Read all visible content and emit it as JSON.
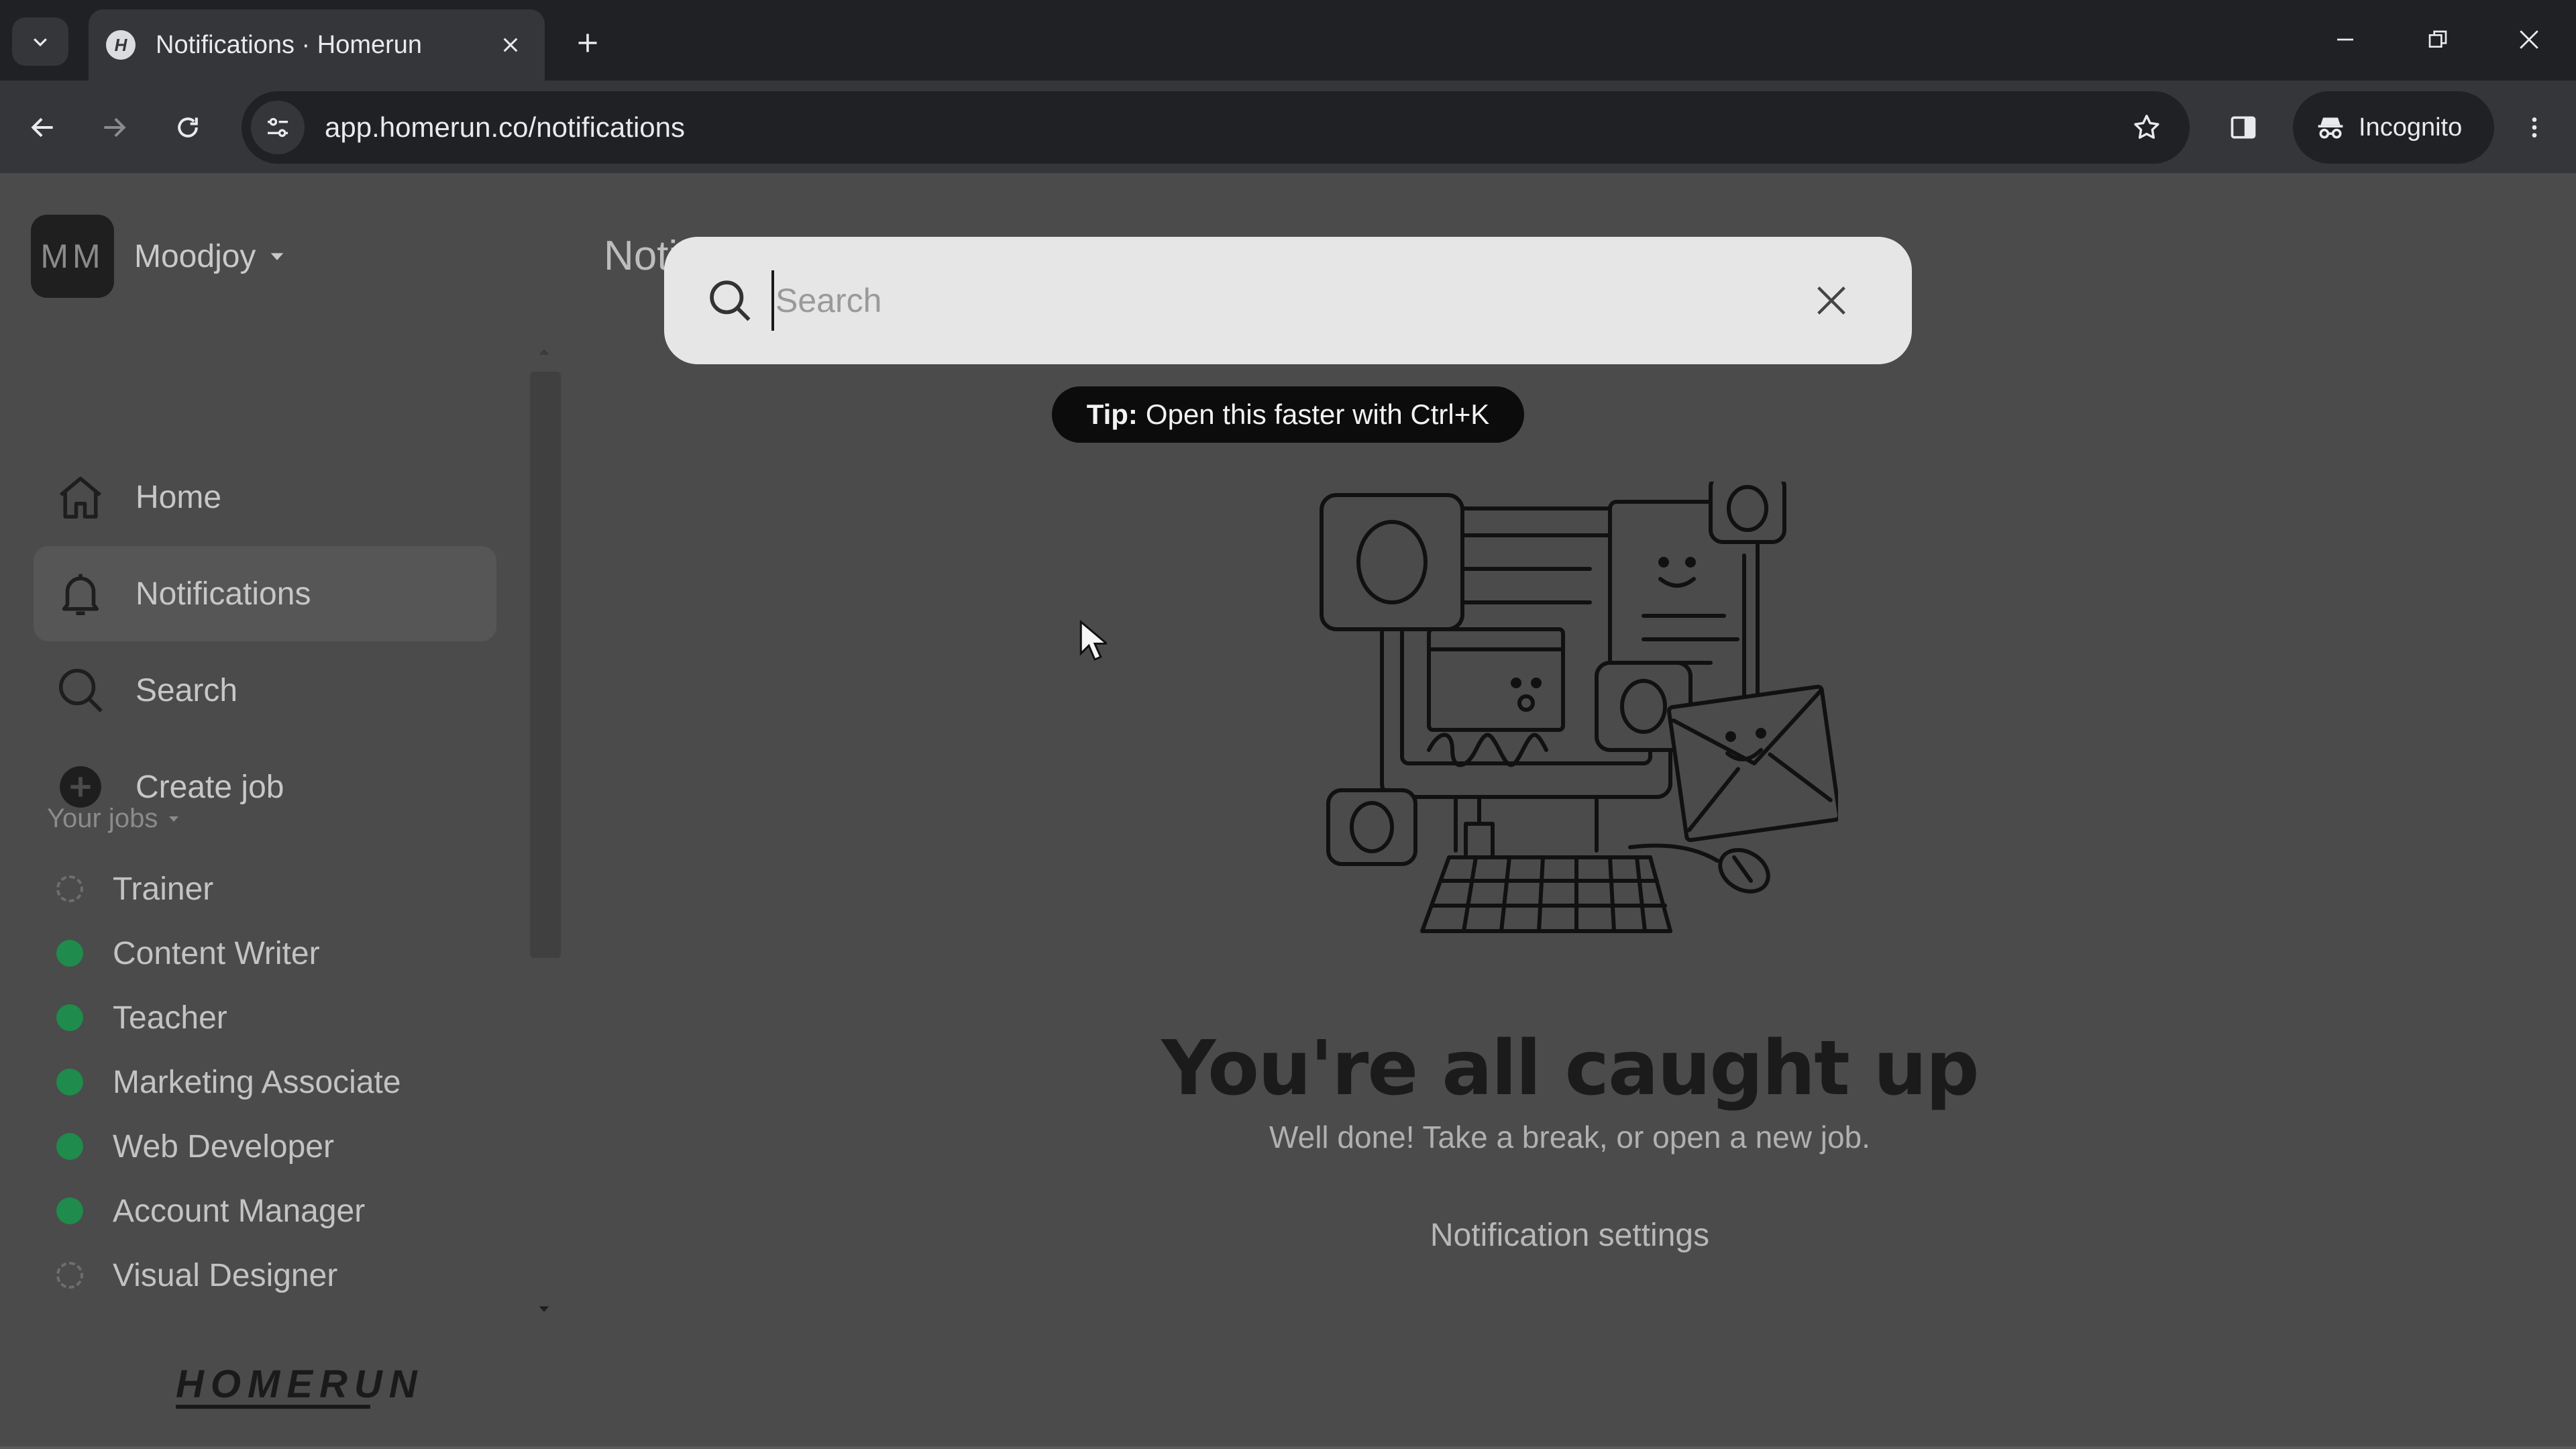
{
  "browser": {
    "tab_title": "Notifications · Homerun",
    "favicon_letter": "H",
    "url": "app.homerun.co/notifications",
    "profile_label": "Incognito"
  },
  "workspace": {
    "initials": "MM",
    "name": "Moodjoy"
  },
  "nav": {
    "items": [
      {
        "label": "Home",
        "icon": "home-icon"
      },
      {
        "label": "Notifications",
        "icon": "bell-icon",
        "active": true
      },
      {
        "label": "Search",
        "icon": "search-icon"
      },
      {
        "label": "Create job",
        "icon": "plus-circle-icon"
      }
    ]
  },
  "jobs": {
    "section_title": "Your jobs",
    "items": [
      {
        "label": "Trainer",
        "status": "draft"
      },
      {
        "label": "Content Writer",
        "status": "published"
      },
      {
        "label": "Teacher",
        "status": "published"
      },
      {
        "label": "Marketing Associate",
        "status": "published"
      },
      {
        "label": "Web Developer",
        "status": "published"
      },
      {
        "label": "Account Manager",
        "status": "published"
      },
      {
        "label": "Visual Designer",
        "status": "draft"
      }
    ]
  },
  "brand": {
    "logo": "HOMERUN"
  },
  "main": {
    "page_title": "Notifications",
    "empty_title": "You're all caught up",
    "empty_subtitle": "Well done! Take a break, or open a new job.",
    "settings_link": "Notification settings"
  },
  "search_modal": {
    "placeholder": "Search",
    "value": ""
  },
  "tip": {
    "label": "Tip:",
    "text": "Open this faster with Ctrl+K"
  },
  "colors": {
    "page_bg": "#4a4b4a",
    "published_dot": "#1f8b4c",
    "modal_bg": "#e6e6e6",
    "tip_bg": "#0c0c0c"
  }
}
